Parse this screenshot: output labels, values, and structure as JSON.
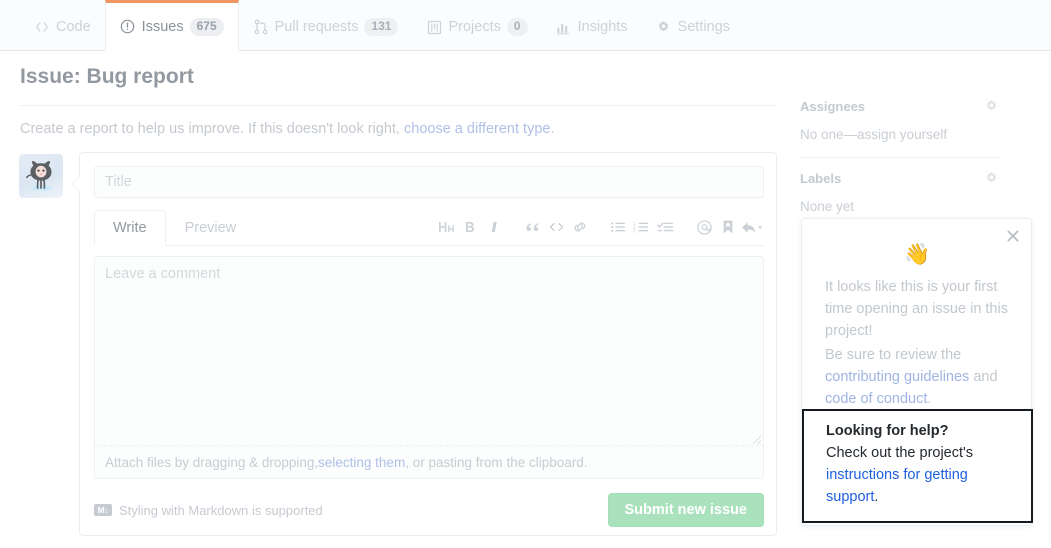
{
  "repo_nav": {
    "tabs": [
      {
        "label": "Code",
        "icon": "code-icon",
        "count": null,
        "active": false
      },
      {
        "label": "Issues",
        "icon": "issue-opened-icon",
        "count": "675",
        "active": true
      },
      {
        "label": "Pull requests",
        "icon": "git-pull-request-icon",
        "count": "131",
        "active": false
      },
      {
        "label": "Projects",
        "icon": "project-icon",
        "count": "0",
        "active": false
      },
      {
        "label": "Insights",
        "icon": "graph-icon",
        "count": null,
        "active": false
      },
      {
        "label": "Settings",
        "icon": "gear-icon",
        "count": null,
        "active": false
      }
    ]
  },
  "page": {
    "title": "Issue: Bug report",
    "description_prefix": "Create a report to help us improve. If this doesn't look right, ",
    "description_link": "choose a different type",
    "description_suffix": "."
  },
  "form": {
    "avatar_icon": "octocat-avatar",
    "title_placeholder": "Title",
    "title_value": "",
    "tabs": [
      {
        "label": "Write",
        "active": true
      },
      {
        "label": "Preview",
        "active": false
      }
    ],
    "toolbar": [
      {
        "name": "heading-icon",
        "label": "Add heading text"
      },
      {
        "name": "bold-icon",
        "label": "Add bold text"
      },
      {
        "name": "italic-icon",
        "label": "Add italic text"
      },
      {
        "name": "quote-icon",
        "label": "Insert a quote"
      },
      {
        "name": "code-icon",
        "label": "Insert code"
      },
      {
        "name": "link-icon",
        "label": "Add a link"
      },
      {
        "name": "unordered-list-icon",
        "label": "Add a bulleted list"
      },
      {
        "name": "ordered-list-icon",
        "label": "Add a numbered list"
      },
      {
        "name": "task-list-icon",
        "label": "Add a task list"
      },
      {
        "name": "mention-icon",
        "label": "Directly mention a user or team"
      },
      {
        "name": "saved-reply-icon",
        "label": "Insert a saved reply"
      },
      {
        "name": "reply-icon",
        "label": "Reply"
      }
    ],
    "comment_placeholder": "Leave a comment",
    "comment_value": "",
    "attach_prefix": "Attach files by dragging & dropping, ",
    "attach_link": "selecting them",
    "attach_suffix": ", or pasting from the clipboard.",
    "markdown_note": "Styling with Markdown is supported",
    "markdown_icon_label": "M↓",
    "submit_label": "Submit new issue",
    "submit_color": "#aae2bd"
  },
  "sidebar": {
    "sections": [
      {
        "title": "Assignees",
        "value": "No one—assign yourself",
        "gear": "gear-icon"
      },
      {
        "title": "Labels",
        "value": "None yet",
        "gear": "gear-icon"
      }
    ]
  },
  "popover": {
    "close_icon": "close-icon",
    "emoji": "👋",
    "paragraph_1": "It looks like this is your first time opening an issue in this project!",
    "para2_prefix": "Be sure to review the ",
    "para2_link_1": "contributing guidelines",
    "para2_middle": " and ",
    "para2_link_2": "code of conduct",
    "para2_suffix": ".",
    "callout": {
      "title": "Looking for help?",
      "text_prefix": "Check out the project's ",
      "link": "instructions for getting support",
      "text_suffix": ".",
      "link_color": "#1f5fe0"
    }
  }
}
